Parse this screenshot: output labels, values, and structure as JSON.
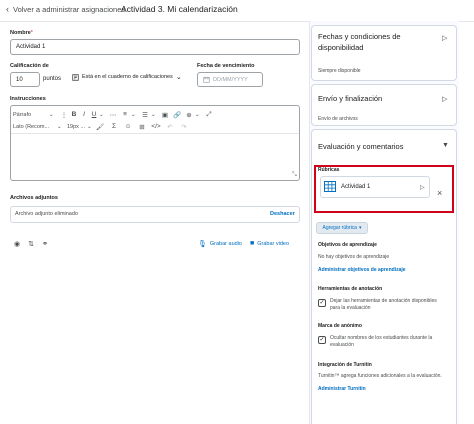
{
  "header": {
    "back_label": "Volver a administrar asignaciones",
    "title": "Actividad 3. Mi calendarización"
  },
  "form": {
    "name_label": "Nombre",
    "required_mark": "*",
    "name_value": "Actividad 1",
    "grade_label": "Calificación de",
    "grade_value": "10",
    "points_label": "puntos",
    "gradebook_label": "Está en el cuaderno de calificaciones",
    "due_label": "Fecha de vencimiento",
    "due_placeholder": "DD/MM/YYYY",
    "instructions_label": "Instrucciones"
  },
  "editor": {
    "paragraph_select": "Párrafo",
    "font_select": "Lato (Recom...",
    "size_select": "19px ..."
  },
  "attachments": {
    "label": "Archivos adjuntos",
    "removed_text": "Archivo adjunto eliminado",
    "undo_label": "Deshacer",
    "record_audio": "Grabar audio",
    "record_video": "Grabar video"
  },
  "panel": {
    "availability": {
      "title": "Fechas y condiciones de disponibilidad",
      "subtitle": "Siempre disponible"
    },
    "submission": {
      "title": "Envío y finalización",
      "subtitle": "Envío de archivos"
    },
    "evaluation": {
      "title": "Evaluación y comentarios",
      "rubrics_label": "Rúbricas",
      "rubric_name": "Actividad 1",
      "add_rubric": "Agregar rúbrica",
      "objectives_label": "Objetivos de aprendizaje",
      "objectives_text": "No hay objetivos de aprendizaje",
      "objectives_link": "Administrar objetivos de aprendizaje",
      "annotation_label": "Herramientas de anotación",
      "annotation_text": "Dejar las herramientas de anotación disponibles para la evaluación",
      "annotation_checked": true,
      "anonymous_label": "Marca de anónimo",
      "anonymous_text": "Ocultar nombres de los estudiantes durante la evaluación",
      "anonymous_checked": true,
      "turnitin_label": "Integración de Turnitin",
      "turnitin_text": "Turnitin™ agrega funciones adicionales a la evaluación.",
      "turnitin_link": "Administrar Turnitin"
    }
  },
  "colors": {
    "link": "#006fbf",
    "highlight": "#d0021b",
    "panel_bg": "#f9fbff"
  }
}
